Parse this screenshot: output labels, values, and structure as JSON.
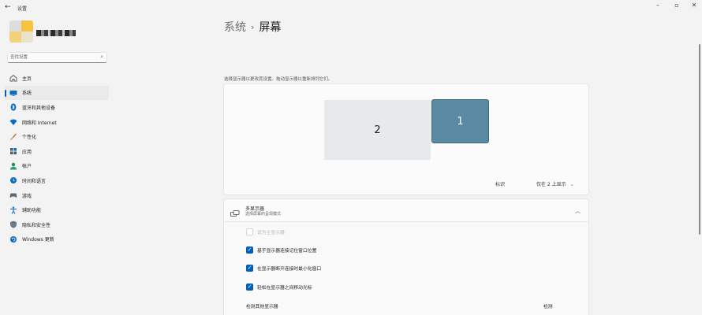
{
  "titlebar": {
    "app_title": "设置",
    "back_icon": "←",
    "minimize_icon": "–",
    "maximize_icon": "▫",
    "close_icon": "✕"
  },
  "search": {
    "placeholder": "查找设置",
    "icon": "⌕"
  },
  "sidebar": {
    "items": [
      {
        "label": "主页",
        "icon": "home-icon",
        "active": false
      },
      {
        "label": "系统",
        "icon": "monitor-icon",
        "active": true
      },
      {
        "label": "蓝牙和其他设备",
        "icon": "bluetooth-icon",
        "active": false
      },
      {
        "label": "网络和 Internet",
        "icon": "wifi-icon",
        "active": false
      },
      {
        "label": "个性化",
        "icon": "brush-icon",
        "active": false
      },
      {
        "label": "应用",
        "icon": "apps-icon",
        "active": false
      },
      {
        "label": "帐户",
        "icon": "person-icon",
        "active": false
      },
      {
        "label": "时间和语言",
        "icon": "globe-clock-icon",
        "active": false
      },
      {
        "label": "游戏",
        "icon": "gamepad-icon",
        "active": false
      },
      {
        "label": "辅助功能",
        "icon": "accessibility-icon",
        "active": false
      },
      {
        "label": "隐私和安全性",
        "icon": "shield-icon",
        "active": false
      },
      {
        "label": "Windows 更新",
        "icon": "update-icon",
        "active": false
      }
    ]
  },
  "breadcrumb": {
    "parent": "系统",
    "separator": "›",
    "current": "屏幕"
  },
  "arrangement": {
    "hint": "选择显示器以更改其设置。拖动显示器以重新排列它们。",
    "monitors": [
      {
        "label": "2",
        "selected": false
      },
      {
        "label": "1",
        "selected": true
      }
    ],
    "identify_label": "标识",
    "display_mode": "仅在 2 上显示",
    "display_mode_chevron": "⌄"
  },
  "multi_display": {
    "title": "多显示器",
    "subtitle": "选择屏幕的呈现模式",
    "collapse_icon": "︿",
    "options": [
      {
        "label": "设为主显示器",
        "checked": false,
        "disabled": true
      },
      {
        "label": "基于显示器连接记住窗口位置",
        "checked": true,
        "disabled": false
      },
      {
        "label": "在显示器断开连接时最小化窗口",
        "checked": true,
        "disabled": false
      },
      {
        "label": "轻松在显示器之间移动光标",
        "checked": true,
        "disabled": false
      }
    ],
    "detect_label": "检测其他显示器",
    "detect_button": "检测",
    "check_glyph": "✓"
  },
  "colors": {
    "accent": "#005fb8",
    "monitor_selected": "#5a8aa3",
    "monitor_other": "#e7eaed",
    "window_bg": "#f3f3f3"
  }
}
